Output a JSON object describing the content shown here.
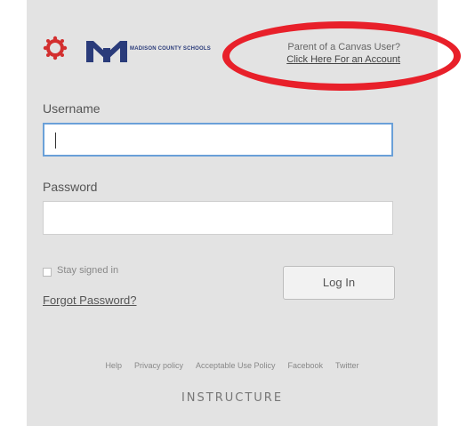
{
  "header": {
    "logo_text": "MADISON COUNTY SCHOOLS",
    "parent_question": "Parent of a Canvas User?",
    "parent_link": "Click Here For an Account"
  },
  "form": {
    "username_label": "Username",
    "username_value": "",
    "password_label": "Password",
    "password_value": "",
    "stay_signed_in": "Stay signed in",
    "stay_signed_in_checked": false,
    "forgot_password": "Forgot Password?",
    "login_button": "Log In"
  },
  "footer": {
    "links": [
      "Help",
      "Privacy policy",
      "Acceptable Use Policy",
      "Facebook",
      "Twitter"
    ],
    "brand": "INSTRUCTURE"
  },
  "colors": {
    "panel_bg": "#e3e3e3",
    "highlight_ellipse": "#e8202a",
    "canvas_logo": "#d32f2f",
    "madison_logo": "#2a3b7a",
    "focus_border": "#6aa0d8"
  },
  "icons": {
    "canvas_logo": "canvas-logo-icon",
    "madison_logo": "madison-county-logo-icon"
  }
}
